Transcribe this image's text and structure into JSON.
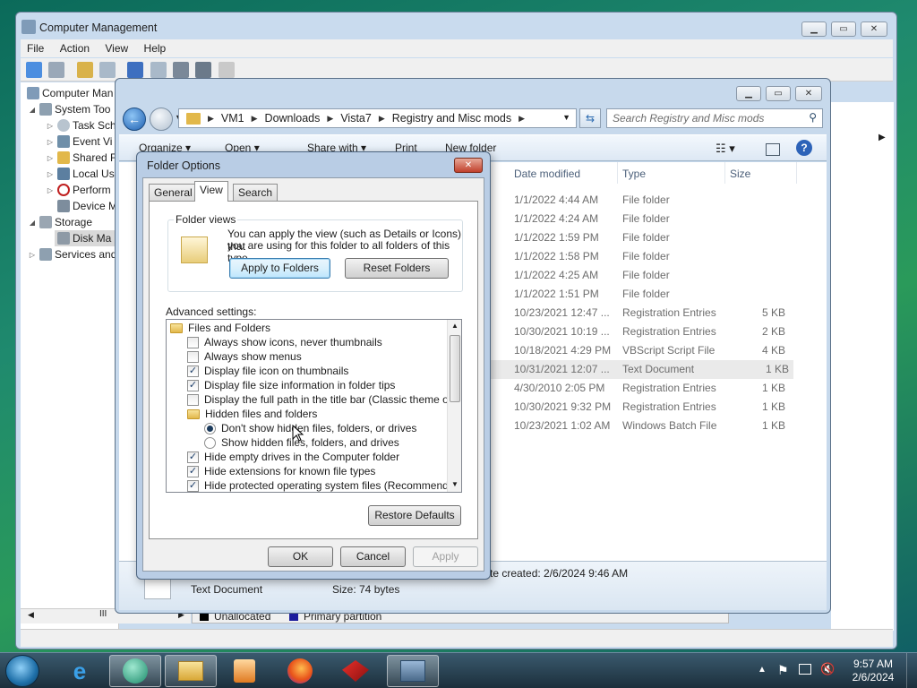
{
  "computer_management": {
    "title": "Computer Management",
    "menu": [
      "File",
      "Action",
      "View",
      "Help"
    ],
    "tree": [
      {
        "label": "Computer Man",
        "level": 0
      },
      {
        "label": "System Too",
        "level": 1
      },
      {
        "label": "Task Sch",
        "level": 2
      },
      {
        "label": "Event Vi",
        "level": 2
      },
      {
        "label": "Shared F",
        "level": 2
      },
      {
        "label": "Local Us",
        "level": 2
      },
      {
        "label": "Perform",
        "level": 2
      },
      {
        "label": "Device M",
        "level": 2
      },
      {
        "label": "Storage",
        "level": 1
      },
      {
        "label": "Disk Ma",
        "level": 2
      },
      {
        "label": "Services and",
        "level": 1
      }
    ],
    "legend": {
      "unallocated": "Unallocated",
      "primary": "Primary partition"
    }
  },
  "explorer": {
    "breadcrumbs": [
      "VM1",
      "Downloads",
      "Vista7",
      "Registry and Misc mods"
    ],
    "search_placeholder": "Search Registry and Misc mods",
    "commands": {
      "organize": "Organize",
      "open": "Open",
      "share": "Share with",
      "print": "Print",
      "new_folder": "New folder"
    },
    "columns": {
      "date": "Date modified",
      "type": "Type",
      "size": "Size"
    },
    "files": [
      {
        "date": "1/1/2022 4:44 AM",
        "type": "File folder",
        "size": ""
      },
      {
        "date": "1/1/2022 4:24 AM",
        "type": "File folder",
        "size": ""
      },
      {
        "date": "1/1/2022 1:59 PM",
        "type": "File folder",
        "size": ""
      },
      {
        "date": "1/1/2022 1:58 PM",
        "type": "File folder",
        "size": ""
      },
      {
        "date": "1/1/2022 4:25 AM",
        "type": "File folder",
        "size": ""
      },
      {
        "date": "1/1/2022 1:51 PM",
        "type": "File folder",
        "size": ""
      },
      {
        "date": "10/23/2021 12:47 ...",
        "type": "Registration Entries",
        "size": "5 KB"
      },
      {
        "date": "10/30/2021 10:19 ...",
        "type": "Registration Entries",
        "size": "2 KB"
      },
      {
        "date": "10/18/2021 4:29 PM",
        "type": "VBScript Script File",
        "size": "4 KB"
      },
      {
        "date": "10/31/2021 12:07 ...",
        "type": "Text Document",
        "size": "1 KB"
      },
      {
        "date": "4/30/2010 2:05 PM",
        "type": "Registration Entries",
        "size": "1 KB"
      },
      {
        "date": "10/30/2021 9:32 PM",
        "type": "Registration Entries",
        "size": "1 KB"
      },
      {
        "date": "10/23/2021 1:02 AM",
        "type": "Windows Batch File",
        "size": "1 KB"
      }
    ],
    "details": {
      "type": "Text Document",
      "size": "Size: 74 bytes",
      "created": "te created: 2/6/2024 9:46 AM"
    }
  },
  "folder_options": {
    "title": "Folder Options",
    "tabs": [
      "General",
      "View",
      "Search"
    ],
    "folder_views": {
      "label": "Folder views",
      "text1": "You can apply the view (such as Details or Icons) that",
      "text2": "you are using for this folder to all folders of this type.",
      "apply": "Apply to Folders",
      "reset": "Reset Folders"
    },
    "advanced_label": "Advanced settings:",
    "settings": [
      {
        "kind": "folder",
        "label": "Files and Folders",
        "indent": 0
      },
      {
        "kind": "check",
        "label": "Always show icons, never thumbnails",
        "checked": false,
        "indent": 1
      },
      {
        "kind": "check",
        "label": "Always show menus",
        "checked": false,
        "indent": 1
      },
      {
        "kind": "check",
        "label": "Display file icon on thumbnails",
        "checked": true,
        "indent": 1
      },
      {
        "kind": "check",
        "label": "Display file size information in folder tips",
        "checked": true,
        "indent": 1
      },
      {
        "kind": "check",
        "label": "Display the full path in the title bar (Classic theme only)",
        "checked": false,
        "indent": 1
      },
      {
        "kind": "folder",
        "label": "Hidden files and folders",
        "indent": 1
      },
      {
        "kind": "radio",
        "label": "Don't show hidden files, folders, or drives",
        "checked": true,
        "indent": 2
      },
      {
        "kind": "radio",
        "label": "Show hidden files, folders, and drives",
        "checked": false,
        "indent": 2
      },
      {
        "kind": "check",
        "label": "Hide empty drives in the Computer folder",
        "checked": true,
        "indent": 1
      },
      {
        "kind": "check",
        "label": "Hide extensions for known file types",
        "checked": true,
        "indent": 1
      },
      {
        "kind": "check",
        "label": "Hide protected operating system files (Recommended)",
        "checked": true,
        "indent": 1
      }
    ],
    "restore": "Restore Defaults",
    "ok": "OK",
    "cancel": "Cancel",
    "apply": "Apply"
  },
  "taskbar": {
    "time": "9:57 AM",
    "date": "2/6/2024"
  }
}
